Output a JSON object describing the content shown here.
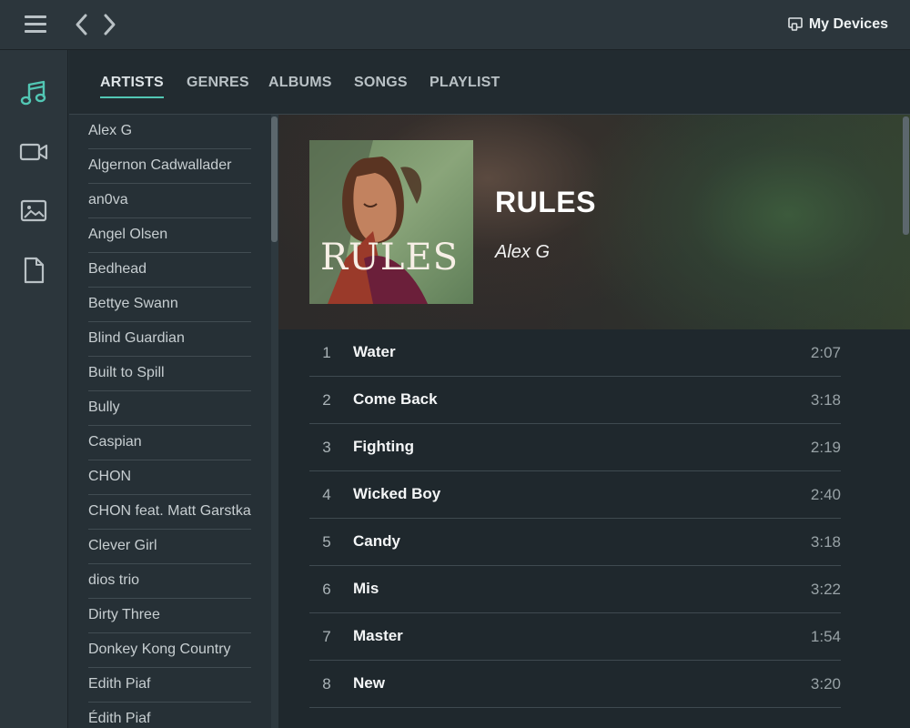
{
  "header": {
    "menu_icon": "hamburger-icon",
    "back_icon": "chevron-left-icon",
    "forward_icon": "chevron-right-icon",
    "devices_icon": "cast-icon",
    "devices_label": "My Devices"
  },
  "rail": {
    "items": [
      {
        "icon": "music-note-icon",
        "active": true
      },
      {
        "icon": "video-camera-icon",
        "active": false
      },
      {
        "icon": "image-icon",
        "active": false
      },
      {
        "icon": "document-icon",
        "active": false
      }
    ]
  },
  "tabs": [
    {
      "label": "ARTISTS",
      "active": true
    },
    {
      "label": "GENRES",
      "active": false
    },
    {
      "label": "ALBUMS",
      "active": false
    },
    {
      "label": "SONGS",
      "active": false
    },
    {
      "label": "PLAYLIST",
      "active": false
    }
  ],
  "artists": [
    "Alex G",
    "Algernon Cadwallader",
    "an0va",
    "Angel Olsen",
    "Bedhead",
    "Bettye Swann",
    "Blind Guardian",
    "Built to Spill",
    "Bully",
    "Caspian",
    "CHON",
    "CHON feat. Matt Garstka",
    "Clever Girl",
    "dios trio",
    "Dirty Three",
    "Donkey Kong Country",
    "Edith Piaf",
    "Édith Piaf"
  ],
  "album": {
    "title": "RULES",
    "artist": "Alex G",
    "cover_text": "RULES",
    "tracks": [
      {
        "number": "1",
        "title": "Water",
        "duration": "2:07"
      },
      {
        "number": "2",
        "title": "Come Back",
        "duration": "3:18"
      },
      {
        "number": "3",
        "title": "Fighting",
        "duration": "2:19"
      },
      {
        "number": "4",
        "title": "Wicked Boy",
        "duration": "2:40"
      },
      {
        "number": "5",
        "title": "Candy",
        "duration": "3:18"
      },
      {
        "number": "6",
        "title": "Mis",
        "duration": "3:22"
      },
      {
        "number": "7",
        "title": "Master",
        "duration": "1:54"
      },
      {
        "number": "8",
        "title": "New",
        "duration": "3:20"
      }
    ]
  },
  "colors": {
    "accent": "#52c7b4",
    "background": "#263036",
    "panel": "#1f282d"
  }
}
